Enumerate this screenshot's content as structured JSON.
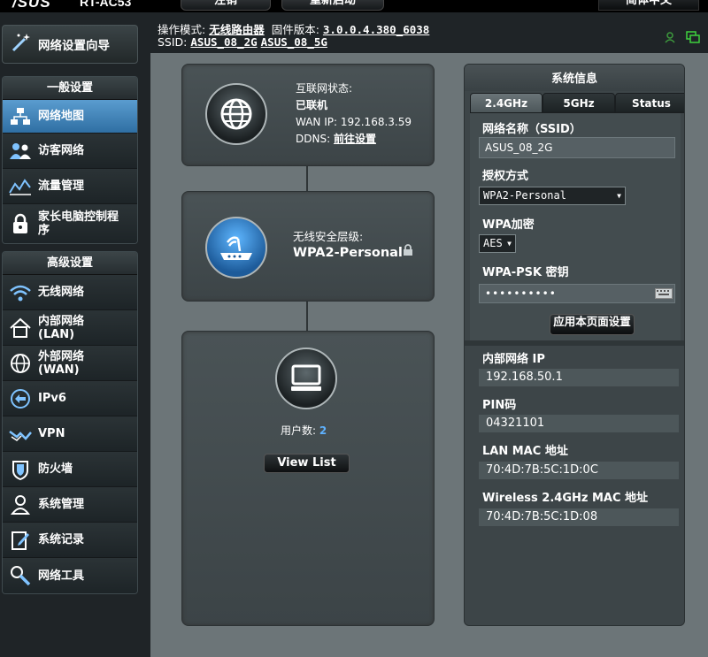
{
  "brand": {
    "logo": "/SUS",
    "model": "RT-AC53"
  },
  "top_buttons": {
    "logout": "注销",
    "reboot": "重新启动",
    "language": "简体中文"
  },
  "header": {
    "mode_label": "操作模式:",
    "mode_value": "无线路由器",
    "firmware_label": "固件版本:",
    "firmware_value": "3.0.0.4.380_6038",
    "ssid_label": "SSID:",
    "ssid_24": "ASUS_08_2G",
    "ssid_5": "ASUS_08_5G"
  },
  "sidebar": {
    "wizard": "网络设置向导",
    "general_title": "一般设置",
    "general_items": [
      {
        "label": "网络地图",
        "icon": "network-map-icon"
      },
      {
        "label": "访客网络",
        "icon": "guest-network-icon"
      },
      {
        "label": "流量管理",
        "icon": "traffic-icon"
      },
      {
        "label": "家长电脑控制程序",
        "icon": "parental-control-icon"
      }
    ],
    "advanced_title": "高级设置",
    "advanced_items": [
      {
        "label": "无线网络",
        "icon": "wireless-icon"
      },
      {
        "label": "内部网络(LAN)",
        "icon": "lan-home-icon"
      },
      {
        "label": "外部网络(WAN)",
        "icon": "wan-globe-icon"
      },
      {
        "label": "IPv6",
        "icon": "ipv6-icon"
      },
      {
        "label": "VPN",
        "icon": "vpn-icon"
      },
      {
        "label": "防火墙",
        "icon": "firewall-shield-icon"
      },
      {
        "label": "系统管理",
        "icon": "admin-user-icon"
      },
      {
        "label": "系统记录",
        "icon": "log-icon"
      },
      {
        "label": "网络工具",
        "icon": "tools-icon"
      }
    ]
  },
  "internet_card": {
    "status_label": "互联网状态:",
    "status_value": "已联机",
    "wan_ip": "WAN IP: 192.168.3.59",
    "ddns_label": "DDNS:",
    "ddns_link": "前往设置"
  },
  "security_card": {
    "label": "无线安全层级:",
    "value": "WPA2-Personal"
  },
  "clients_card": {
    "label": "用户数:",
    "count": "2",
    "button": "View List"
  },
  "system_info": {
    "title": "系统信息",
    "tabs": [
      "2.4GHz",
      "5GHz",
      "Status"
    ],
    "ssid_label": "网络名称（SSID）",
    "ssid_value": "ASUS_08_2G",
    "auth_label": "授权方式",
    "auth_value": "WPA2-Personal",
    "wpa_label": "WPA加密",
    "wpa_value": "AES",
    "psk_label": "WPA-PSK 密钥",
    "psk_value": "••••••••••",
    "apply": "应用本页面设置",
    "lan_ip_label": "内部网络 IP",
    "lan_ip_value": "192.168.50.1",
    "pin_label": "PIN码",
    "pin_value": "04321101",
    "lan_mac_label": "LAN MAC 地址",
    "lan_mac_value": "70:4D:7B:5C:1D:0C",
    "wl_mac_label": "Wireless 2.4GHz MAC 地址",
    "wl_mac_value": "70:4D:7B:5C:1D:08"
  },
  "colors": {
    "active_blue": "#4a8ec4",
    "link_blue": "#5fb2ff",
    "panel": "#3d4548",
    "main_bg": "#6c7578"
  }
}
